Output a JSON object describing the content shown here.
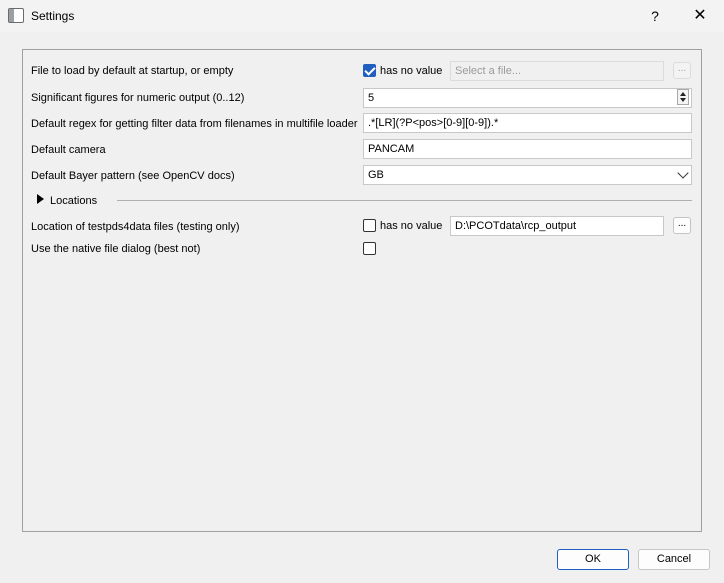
{
  "window": {
    "title": "Settings",
    "help_glyph": "?",
    "close_glyph": "✕"
  },
  "rows": {
    "default_file": {
      "label": "File to load by default at startup, or empty",
      "checkbox_label": "has no value",
      "checked": true,
      "placeholder": "Select a file...",
      "browse": "..."
    },
    "sig_figs": {
      "label": "Significant figures for numeric output (0..12)",
      "value": "5"
    },
    "regex": {
      "label": "Default regex for getting filter data from filenames in multifile loader",
      "value": ".*[LR](?P<pos>[0-9][0-9]).*"
    },
    "camera": {
      "label": "Default camera",
      "value": "PANCAM"
    },
    "bayer": {
      "label": "Default Bayer pattern (see OpenCV docs)",
      "value": "GB"
    }
  },
  "locations": {
    "header": "Locations",
    "testpds": {
      "label": "Location of testpds4data files (testing only)",
      "checkbox_label": "has no value",
      "checked": false,
      "value": "D:\\PCOTdata\\rcp_output",
      "browse": "..."
    },
    "native_dialog": {
      "label": "Use the native file dialog (best not)",
      "checked": false
    }
  },
  "buttons": {
    "ok": "OK",
    "cancel": "Cancel"
  }
}
